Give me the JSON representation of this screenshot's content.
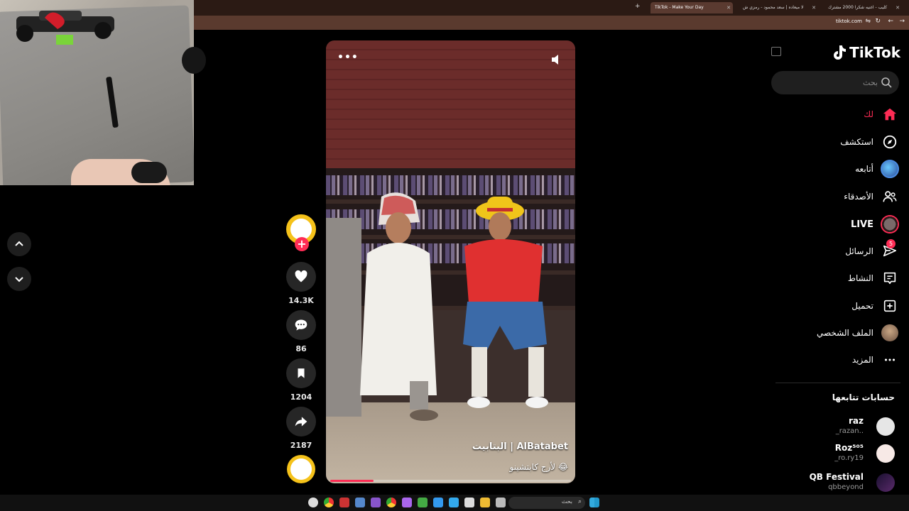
{
  "browser": {
    "tabs": [
      {
        "label": "TikTok - Make Your Day",
        "active": true
      },
      {
        "label": "لا ميعاده | سعد محمود - رمزي ش",
        "active": false
      },
      {
        "label": "كليب - اغنيه شكرا 2000 مشترك",
        "active": false
      }
    ],
    "url": "tiktok.com"
  },
  "feed_nav": {
    "up_icon": "chevron-up-icon",
    "down_icon": "chevron-down-icon"
  },
  "video": {
    "title": "البتابيت | AlBatabet",
    "description": "لأرج كابتشينو 😂",
    "progress_percent": 18,
    "more_icon": "more-dots-icon",
    "volume_icon": "volume-icon"
  },
  "actions": {
    "likes": "14.3K",
    "comments": "86",
    "saves": "1204",
    "shares": "2187",
    "follow_icon": "plus-icon"
  },
  "sidebar": {
    "logo": "TikTok",
    "search_placeholder": "بحث",
    "nav": [
      {
        "label": "لك",
        "icon": "home-icon",
        "active": true
      },
      {
        "label": "استكشف",
        "icon": "compass-icon"
      },
      {
        "label": "أتابعه",
        "icon": "following-avatar-icon"
      },
      {
        "label": "LIVE",
        "icon": "live-icon"
      },
      {
        "label": "الأصدقاء",
        "icon": "friends-icon"
      },
      {
        "label": "الرسائل",
        "icon": "messages-icon",
        "badge": "5"
      },
      {
        "label": "النشاط",
        "icon": "activity-icon"
      },
      {
        "label": "تحميل",
        "icon": "upload-icon"
      },
      {
        "label": "الملف الشخصي",
        "icon": "profile-avatar-icon"
      },
      {
        "label": "المزيد",
        "icon": "more-icon"
      }
    ],
    "following_heading": "حسابات تتابعها",
    "accounts": [
      {
        "name": "raz",
        "handle": "_razan..",
        "color": "#e6e6e6"
      },
      {
        "name": "Roz⁵⁰⁵",
        "handle": "_ro.ry19",
        "color": "#f7e9e6"
      },
      {
        "name": "QB Festival",
        "handle": "qbbeyond",
        "color": "#1a1030"
      }
    ]
  },
  "taskbar": {
    "search_label": "بحث"
  },
  "colors": {
    "accent": "#fe2c55",
    "background": "#000000",
    "sidebar_text": "#ffffff"
  }
}
